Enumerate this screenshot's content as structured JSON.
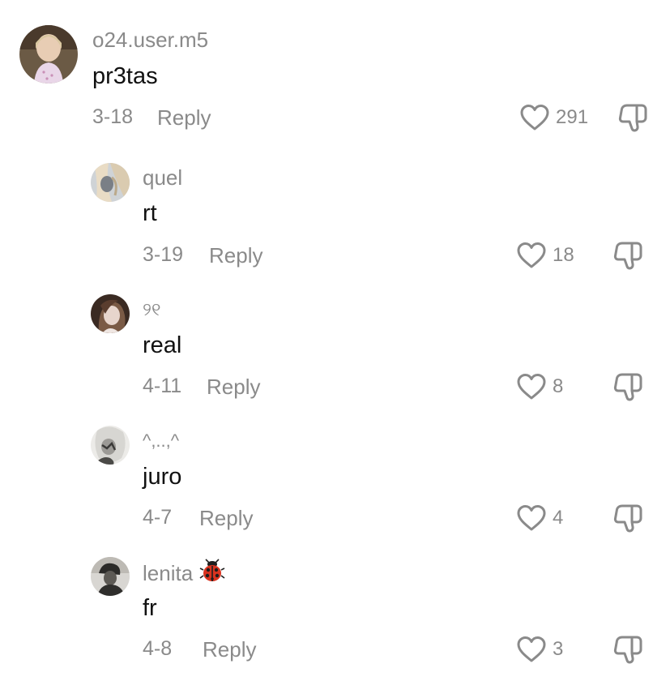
{
  "colors": {
    "text_primary": "#111111",
    "text_secondary": "#8a8a8a",
    "background": "#ffffff"
  },
  "comments": [
    {
      "username": "o24.user.m5",
      "text": "pr3tas",
      "date": "3-18",
      "reply_label": "Reply",
      "likes": "291",
      "level": "top"
    },
    {
      "username": "quel",
      "text": "rt",
      "date": "3-19",
      "reply_label": "Reply",
      "likes": "18",
      "level": "reply"
    },
    {
      "username": "୨୧",
      "text": "real",
      "date": "4-11",
      "reply_label": "Reply",
      "likes": "8",
      "level": "reply"
    },
    {
      "username": "^,..,^",
      "text": "juro",
      "date": "4-7",
      "reply_label": "Reply",
      "likes": "4",
      "level": "reply"
    },
    {
      "username": "lenita",
      "username_icon": "ladybug-icon",
      "text": "fr",
      "date": "4-8",
      "reply_label": "Reply",
      "likes": "3",
      "level": "reply"
    }
  ],
  "icons": {
    "like": "heart-outline-icon",
    "dislike": "thumbs-down-outline-icon"
  }
}
